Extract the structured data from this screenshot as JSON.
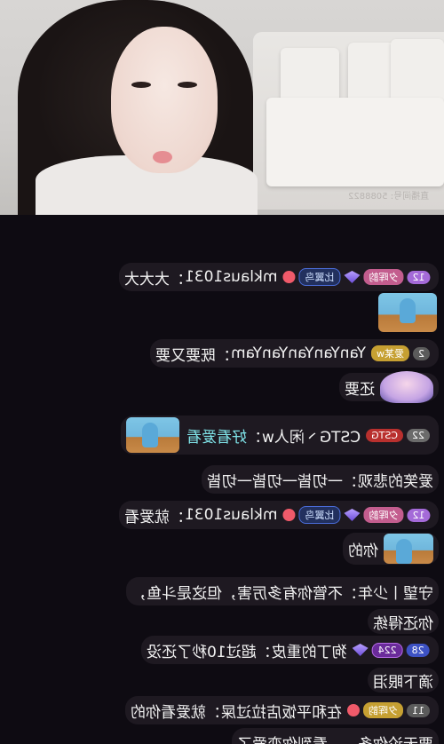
{
  "stream": {
    "room_id_text": "直播间号: 5088822"
  },
  "messages": [
    {
      "level": "12",
      "user_level": "夕晖韵",
      "tag": "比翼鸟",
      "user": "mklaus1031",
      "sep": "：",
      "text": "大大大"
    },
    {
      "level": "2",
      "user_level": "爱某w",
      "user": "YanYanYanYanYam",
      "sep": "：",
      "text": "既要又要",
      "cont": "还要"
    },
    {
      "level": "22",
      "tag": "CSTG",
      "user": "CSTG丶闲人w",
      "sep": "：",
      "text": "好看爱看"
    },
    {
      "user": "爱笑的悲观",
      "sep": "：",
      "text": "一切皆一切皆一切皆"
    },
    {
      "level": "12",
      "user_level": "夕晖韵",
      "tag": "比翼鸟",
      "user": "mklaus1031",
      "sep": "：",
      "text": "就爱看",
      "cont": "你的"
    },
    {
      "user": "守望丨少年",
      "sep": "：",
      "text": "不管你有多厉害，但这是斗鱼，",
      "cont": "你还得练"
    },
    {
      "level": "28",
      "badge_num": "224",
      "user": "狗丁的重皮",
      "sep": "：",
      "text": "超过10秒了还没",
      "cont": "滴下眼泪"
    },
    {
      "level": "11",
      "user_level": "夕晖韵",
      "user": "在和平饭店拉过屎",
      "sep": "：",
      "text": "就爱看你的"
    },
    {
      "text": "要无论你多……看到你恋爱了"
    }
  ]
}
